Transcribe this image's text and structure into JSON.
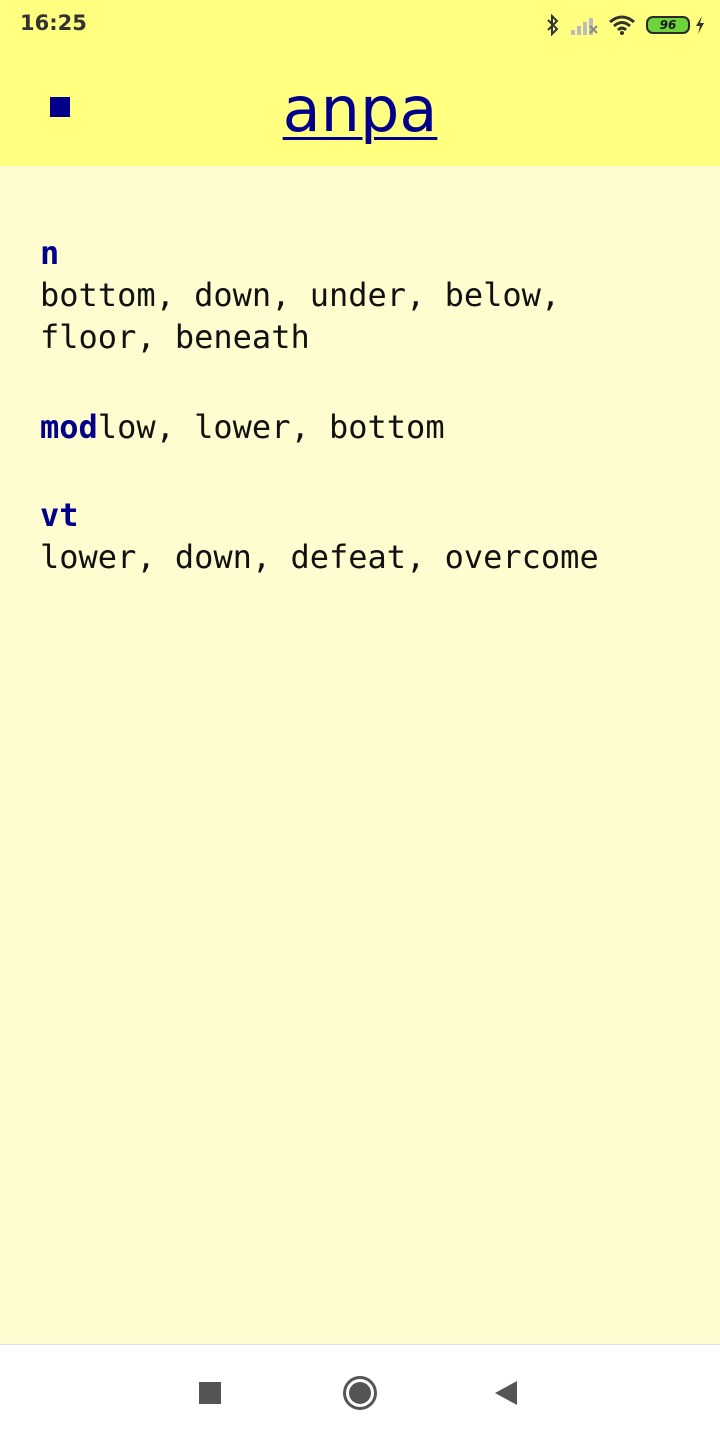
{
  "status_bar": {
    "time": "16:25",
    "battery": "96",
    "icons": [
      "bluetooth-icon",
      "signal-icon",
      "wifi-icon",
      "battery-icon",
      "charging-icon"
    ]
  },
  "app_bar": {
    "title": "anpa",
    "menu_icon": "menu-square-icon"
  },
  "entries": [
    {
      "pos": "n",
      "definition": "bottom, down, under, below, floor, beneath"
    },
    {
      "pos": "mod",
      "definition": "low, lower, bottom"
    },
    {
      "pos": "vt",
      "definition": "lower, down, defeat, overcome"
    }
  ],
  "nav_bar": {
    "buttons": [
      "recents-square-icon",
      "home-circle-icon",
      "back-triangle-icon"
    ]
  },
  "colors": {
    "app_bar_bg": "#ffff80",
    "page_bg": "#fffdd0",
    "accent": "#00008b",
    "text": "#111111"
  }
}
